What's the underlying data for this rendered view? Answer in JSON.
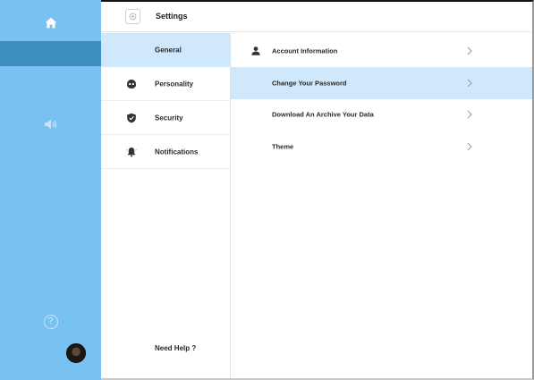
{
  "header": {
    "title": "Settings"
  },
  "categories": [
    {
      "label": "General",
      "icon": "none",
      "active": true
    },
    {
      "label": "Personality",
      "icon": "mask-icon",
      "active": false
    },
    {
      "label": "Security",
      "icon": "shield-icon",
      "active": false
    },
    {
      "label": "Notifications",
      "icon": "bell-icon",
      "active": false
    }
  ],
  "help_link": "Need Help ?",
  "options": [
    {
      "label": "Account Information",
      "icon": "user-icon",
      "active": false
    },
    {
      "label": "Change Your Password",
      "icon": "none",
      "active": true
    },
    {
      "label": "Download An Archive Your Data",
      "icon": "none",
      "active": false
    },
    {
      "label": "Theme",
      "icon": "none",
      "active": false
    }
  ],
  "rail": {
    "items": [
      "home-icon",
      "sound-icon",
      "help-icon",
      "avatar"
    ]
  },
  "colors": {
    "rail": "#78c2f1",
    "rail_active": "#3d8dbe",
    "highlight": "#cfe8fb"
  }
}
